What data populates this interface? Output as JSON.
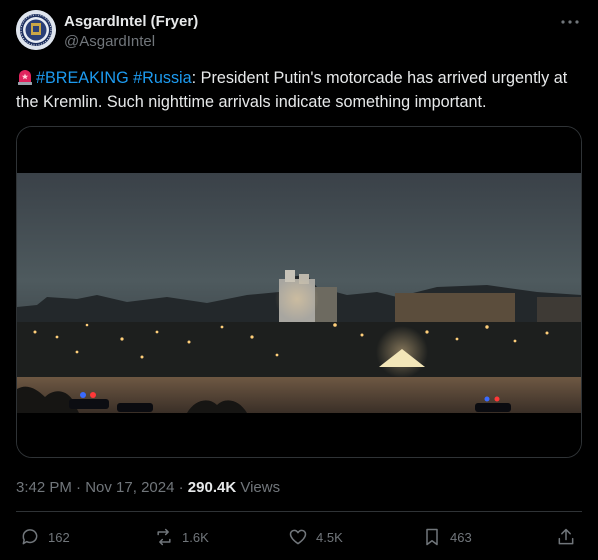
{
  "author": {
    "display_name": "AsgardIntel (Fryer)",
    "handle": "@AsgardIntel",
    "avatar_icon": "seal-avatar-icon"
  },
  "tweet": {
    "emoji": "siren-icon",
    "hashtags": [
      "#BREAKING",
      "#Russia"
    ],
    "text_after_hashtags": ": President Putin's motorcade has arrived urgently at the Kremlin. Such nighttime arrivals indicate something important."
  },
  "meta": {
    "time": "3:42 PM",
    "separator": "·",
    "date": "Nov 17, 2024",
    "views_count": "290.4K",
    "views_label": "Views"
  },
  "actions": {
    "reply_count": "162",
    "repost_count": "1.6K",
    "like_count": "4.5K",
    "bookmark_count": "463"
  },
  "colors": {
    "background": "#000000",
    "text": "#e7e9ea",
    "secondary": "#71767b",
    "link": "#1d9bf0",
    "border": "#2f3336"
  }
}
